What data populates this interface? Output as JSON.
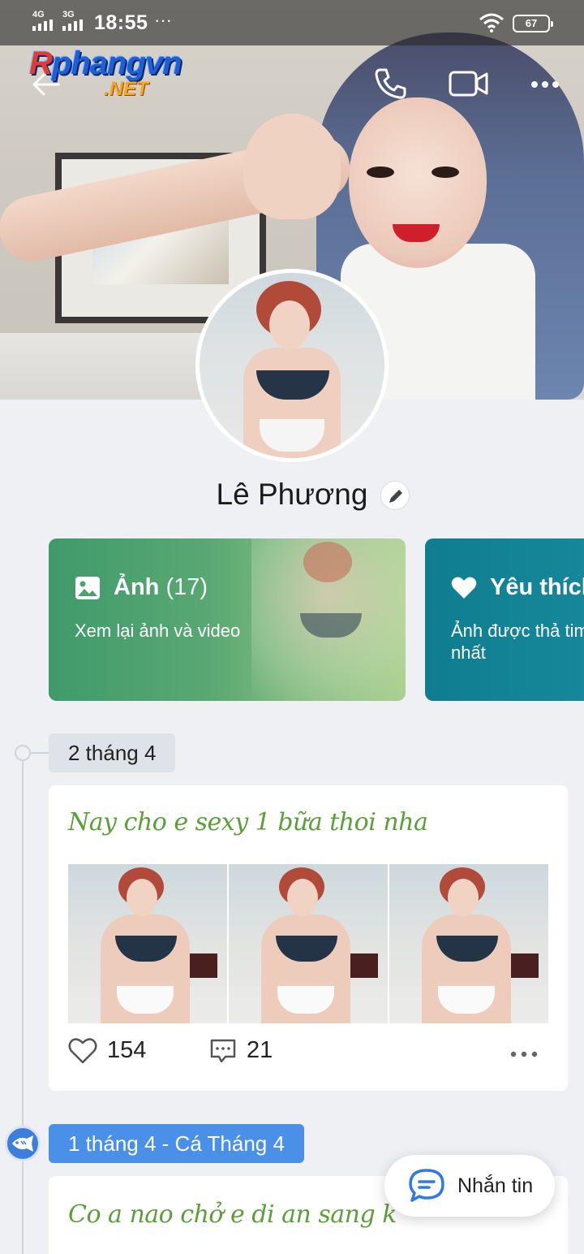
{
  "statusbar": {
    "net1": "4G",
    "net2": "3G",
    "time": "18:55",
    "dots": "···",
    "battery": "67"
  },
  "watermark": {
    "main_r": "R",
    "main": "phangvn",
    "sub": ".NET"
  },
  "profile": {
    "name": "Lê Phương"
  },
  "cards": {
    "photos": {
      "title": "Ảnh",
      "count": "(17)",
      "subtitle": "Xem lại ảnh và video",
      "icon": "image-icon"
    },
    "likes": {
      "title": "Yêu thích",
      "subtitle": "Ảnh được thả tim\nnhất",
      "icon": "heart-icon"
    }
  },
  "timeline": [
    {
      "date": "2 tháng 4",
      "text": "Nay cho e sexy 1 bữa thoi nha",
      "likes": "154",
      "comments": "21",
      "images": 3
    },
    {
      "date": "1 tháng 4 - Cá Tháng 4",
      "text": "Co a nao chở e di an sang k"
    }
  ],
  "fab": {
    "label": "Nhắn tin",
    "icon": "chat-bubble-icon"
  },
  "colors": {
    "photos_card": "#3f9a6b",
    "likes_card": "#0f7d8f",
    "date_tag_special": "#4a90e8",
    "post_text": "#5c9e3a"
  }
}
